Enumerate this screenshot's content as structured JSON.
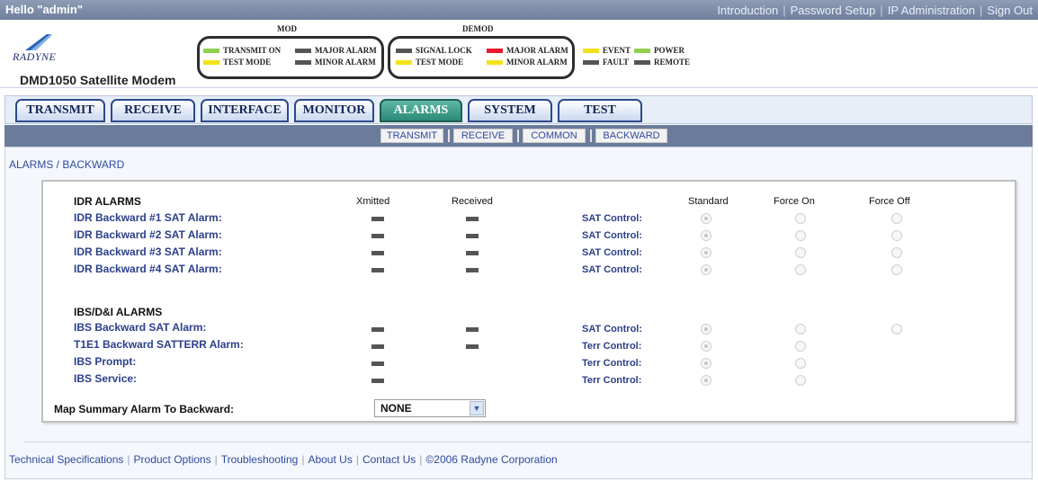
{
  "topbar": {
    "greeting": "Hello \"admin\"",
    "links": [
      "Introduction",
      "Password Setup",
      "IP Administration",
      "Sign Out"
    ]
  },
  "header": {
    "logo_text": "RADYNE",
    "model": "DMD1050 Satellite Modem",
    "mod_title": "MOD",
    "demod_title": "DEMOD",
    "leds": {
      "transmit_on": {
        "label": "TRANSMIT ON",
        "color": "#8fd14f"
      },
      "test_mode_mod": {
        "label": "TEST MODE",
        "color": "#f2e21b"
      },
      "major_alarm_mod": {
        "label": "MAJOR ALARM",
        "color": "#555555"
      },
      "minor_alarm_mod": {
        "label": "MINOR ALARM",
        "color": "#555555"
      },
      "signal_lock": {
        "label": "SIGNAL LOCK",
        "color": "#555555"
      },
      "test_mode_demod": {
        "label": "TEST MODE",
        "color": "#f2e21b"
      },
      "major_alarm_demod": {
        "label": "MAJOR ALARM",
        "color": "#e8192c"
      },
      "minor_alarm_demod": {
        "label": "MINOR ALARM",
        "color": "#f2e21b"
      },
      "event": {
        "label": "EVENT",
        "color": "#f2e21b"
      },
      "fault": {
        "label": "FAULT",
        "color": "#555555"
      },
      "power": {
        "label": "POWER",
        "color": "#8fd14f"
      },
      "remote": {
        "label": "REMOTE",
        "color": "#555555"
      }
    }
  },
  "tabs": [
    "TRANSMIT",
    "RECEIVE",
    "INTERFACE",
    "MONITOR",
    "ALARMS",
    "SYSTEM",
    "TEST"
  ],
  "active_tab": "ALARMS",
  "subtabs": [
    "TRANSMIT",
    "RECEIVE",
    "COMMON",
    "BACKWARD"
  ],
  "breadcrumb": "ALARMS / BACKWARD",
  "columns": {
    "xmitted": "Xmitted",
    "received": "Received",
    "standard": "Standard",
    "force_on": "Force On",
    "force_off": "Force Off"
  },
  "idr": {
    "heading": "IDR ALARMS",
    "rows": [
      {
        "label": "IDR Backward #1 SAT Alarm:",
        "control": "SAT Control:"
      },
      {
        "label": "IDR Backward #2 SAT Alarm:",
        "control": "SAT Control:"
      },
      {
        "label": "IDR Backward #3 SAT Alarm:",
        "control": "SAT Control:"
      },
      {
        "label": "IDR Backward #4 SAT Alarm:",
        "control": "SAT Control:"
      }
    ]
  },
  "ibs": {
    "heading": "IBS/D&I ALARMS",
    "rows": [
      {
        "label": "IBS Backward SAT Alarm:",
        "control": "SAT Control:"
      },
      {
        "label": "T1E1 Backward SATTERR Alarm:",
        "control": "Terr Control:"
      },
      {
        "label": "IBS Prompt:",
        "control": "Terr Control:"
      },
      {
        "label": "IBS Service:",
        "control": "Terr Control:"
      }
    ]
  },
  "map_summary": {
    "label": "Map Summary Alarm To Backward:",
    "value": "NONE"
  },
  "footer": {
    "links": [
      "Technical Specifications",
      "Product Options",
      "Troubleshooting",
      "About Us",
      "Contact Us",
      "©2006 Radyne Corporation"
    ]
  }
}
